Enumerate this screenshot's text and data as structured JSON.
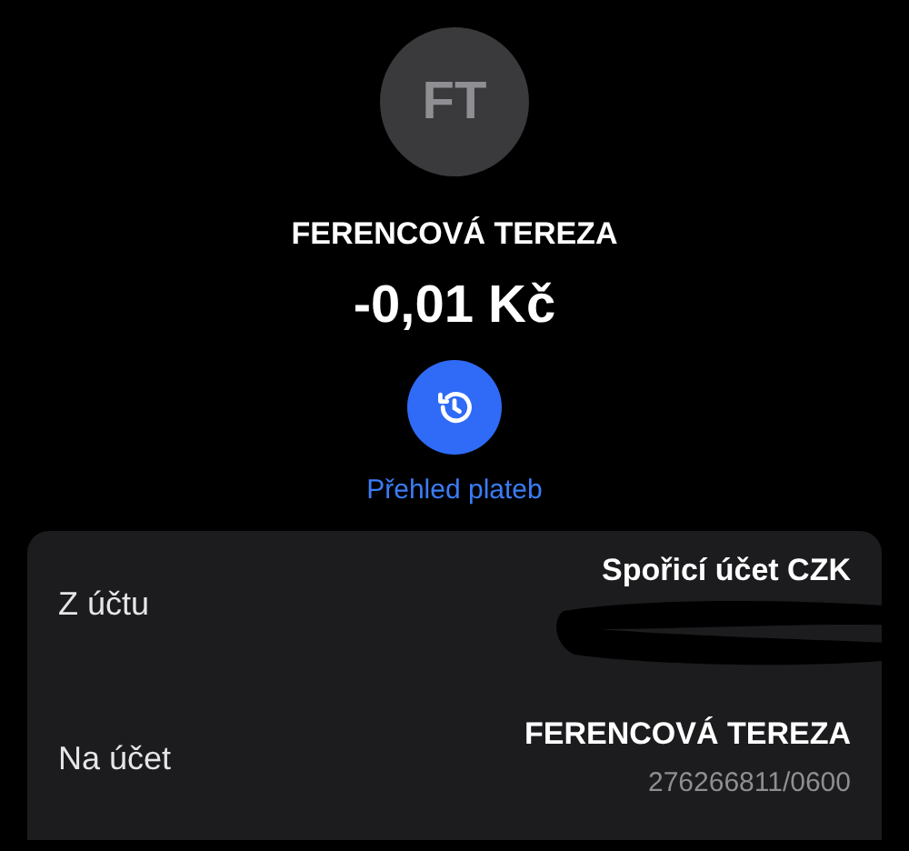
{
  "contact": {
    "initials": "FT",
    "name": "FERENCOVÁ TEREZA"
  },
  "amount": "-0,01 Kč",
  "history_link": {
    "label": "Přehled plateb"
  },
  "details": [
    {
      "label": "Z účtu",
      "value": "Spořicí účet CZK",
      "redacted": true
    },
    {
      "label": "Na účet",
      "value": "FERENCOVÁ TEREZA",
      "sub": "276266811/0600",
      "redacted": false
    }
  ]
}
